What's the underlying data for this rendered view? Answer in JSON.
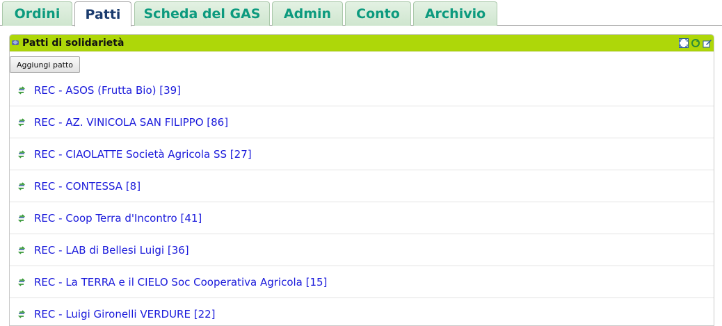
{
  "tabs": [
    {
      "label": "Ordini",
      "active": false
    },
    {
      "label": "Patti",
      "active": true
    },
    {
      "label": "Scheda del GAS",
      "active": false
    },
    {
      "label": "Admin",
      "active": false
    },
    {
      "label": "Conto",
      "active": false
    },
    {
      "label": "Archivio",
      "active": false
    }
  ],
  "portlet": {
    "title": "Patti di solidarietà",
    "header_color": "#aed709",
    "tools": [
      "maximize-icon",
      "refresh-icon",
      "edit-icon"
    ],
    "add_button_label": "Aggiungi patto"
  },
  "patti": [
    {
      "label": "REC - ASOS (Frutta Bio) [39]"
    },
    {
      "label": "REC - AZ. VINICOLA SAN FILIPPO [86]"
    },
    {
      "label": "REC - CIAOLATTE Società Agricola SS [27]"
    },
    {
      "label": "REC - CONTESSA [8]"
    },
    {
      "label": "REC - Coop Terra d'Incontro [41]"
    },
    {
      "label": "REC - LAB di Bellesi Luigi [36]"
    },
    {
      "label": "REC - La TERRA e il CIELO Soc Cooperativa Agricola [15]"
    },
    {
      "label": "REC - Luigi Gironelli VERDURE [22]"
    }
  ],
  "colors": {
    "tab_text": "#0c9a7e",
    "tab_active_text": "#1a3b6e",
    "link": "#1a1adb"
  }
}
